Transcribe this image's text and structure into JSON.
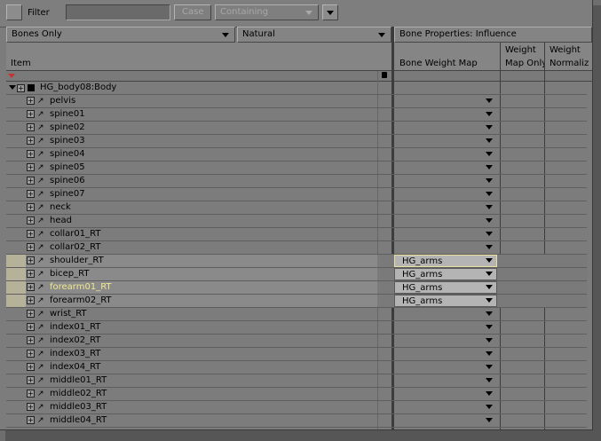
{
  "toolbar": {
    "filter_label": "Filter",
    "filter_value": "",
    "case_label": "Case",
    "match_mode": "Containing"
  },
  "left_panel": {
    "type_filter": "Bones Only",
    "sort_mode": "Natural",
    "item_header": "Item"
  },
  "right_panel": {
    "properties_title": "Bone Properties: Influence",
    "col_weight_map": "Bone Weight Map",
    "col_map_only_1": "Weight",
    "col_map_only_2": "Map Only",
    "col_normalize_1": "Weight",
    "col_normalize_2": "Normaliz"
  },
  "root_item": "HG_body08:Body",
  "rows": [
    {
      "name": "pelvis",
      "weight_map": ""
    },
    {
      "name": "spine01",
      "weight_map": ""
    },
    {
      "name": "spine02",
      "weight_map": ""
    },
    {
      "name": "spine03",
      "weight_map": ""
    },
    {
      "name": "spine04",
      "weight_map": ""
    },
    {
      "name": "spine05",
      "weight_map": ""
    },
    {
      "name": "spine06",
      "weight_map": ""
    },
    {
      "name": "spine07",
      "weight_map": ""
    },
    {
      "name": "neck",
      "weight_map": ""
    },
    {
      "name": "head",
      "weight_map": ""
    },
    {
      "name": "collar01_RT",
      "weight_map": ""
    },
    {
      "name": "collar02_RT",
      "weight_map": ""
    },
    {
      "name": "shoulder_RT",
      "weight_map": "HG_arms",
      "selected": true
    },
    {
      "name": "bicep_RT",
      "weight_map": "HG_arms",
      "selected": true
    },
    {
      "name": "forearm01_RT",
      "weight_map": "HG_arms",
      "selected": true,
      "highlight": true
    },
    {
      "name": "forearm02_RT",
      "weight_map": "HG_arms",
      "selected": true
    },
    {
      "name": "wrist_RT",
      "weight_map": ""
    },
    {
      "name": "index01_RT",
      "weight_map": ""
    },
    {
      "name": "index02_RT",
      "weight_map": ""
    },
    {
      "name": "index03_RT",
      "weight_map": ""
    },
    {
      "name": "index04_RT",
      "weight_map": ""
    },
    {
      "name": "middle01_RT",
      "weight_map": ""
    },
    {
      "name": "middle02_RT",
      "weight_map": ""
    },
    {
      "name": "middle03_RT",
      "weight_map": ""
    },
    {
      "name": "middle04_RT",
      "weight_map": ""
    }
  ]
}
